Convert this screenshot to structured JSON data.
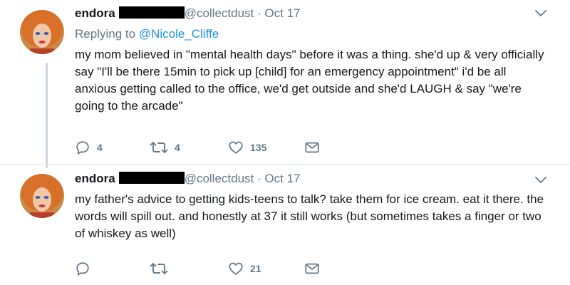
{
  "tweets": [
    {
      "name": "endora",
      "handle": "@collectdust",
      "separator": "·",
      "time": "Oct 17",
      "replying_prefix": "Replying to",
      "replying_to": "@Nicole_Cliffe",
      "text": "my mom believed in \"mental health days\" before it was a thing. she'd up & very officially say \"I'll be there 15min to pick up [child] for an emergency appointment\" i'd be all anxious getting called to the office, we'd get outside and she'd LAUGH & say \"we're going to the arcade\"",
      "replies": "4",
      "retweets": "4",
      "likes": "135"
    },
    {
      "name": "endora",
      "handle": "@collectdust",
      "separator": "·",
      "time": "Oct 17",
      "text": "my father's advice to getting kids-teens to talk? take them for ice cream. eat it there. the words will spill out. and honestly at 37 it still works (but sometimes takes a finger or two of whiskey as well)",
      "replies": "",
      "retweets": "",
      "likes": "21"
    }
  ],
  "icons": [
    "reply-icon",
    "retweet-icon",
    "like-icon",
    "message-icon",
    "caret-down-icon"
  ],
  "colors": {
    "text": "#14171a",
    "muted": "#657786",
    "link": "#1b95e0",
    "divider": "#e6ecf0",
    "redaction": "#000000"
  }
}
